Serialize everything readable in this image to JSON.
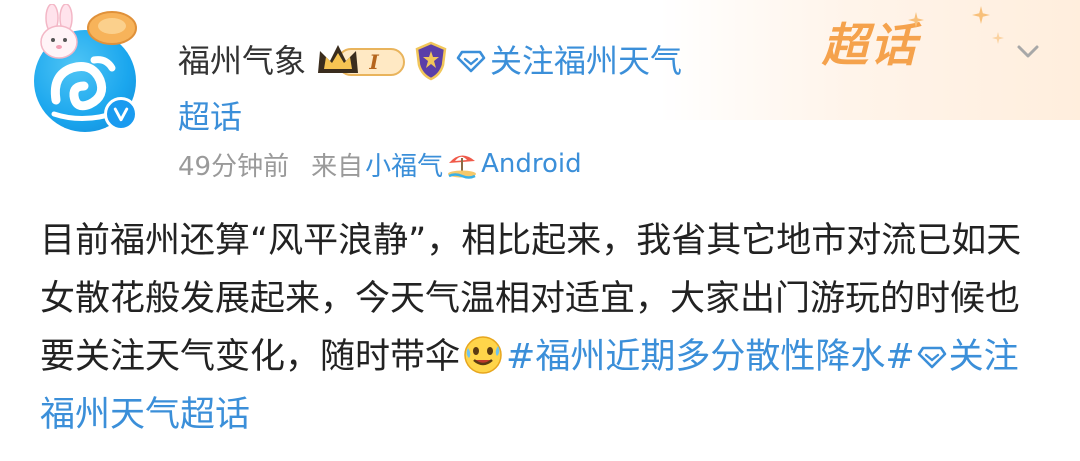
{
  "post": {
    "author": "福州气象",
    "level_badge": "I",
    "supertopic_link_line1": "关注福州天气",
    "supertopic_link_line2": "超话",
    "time_ago": "49分钟前",
    "from_label": "来自",
    "source_name": "小福气",
    "platform": "Android",
    "corner_label": "超话",
    "body_text": "目前福州还算“风平浪静”，相比起来，我省其它地市对流已如天女散花般发展起来，今天气温相对适宜，大家出门游玩的时候也要关注天气变化，随时带伞",
    "hashtag_text": "#福州近期多分散性降水#",
    "supertopic_tag": "关注福州天气超话"
  },
  "colors": {
    "link_blue": "#3b8fd9",
    "meta_gray": "#9a9a9a",
    "corner_orange": "#f5a24c",
    "verified_blue": "#1a9bf0"
  },
  "icons": {
    "avatar": "fuzhou-weather-avatar",
    "verified": "verified-v-icon",
    "crown_badge": "crown-level-icon",
    "guard": "shield-guard-icon",
    "supertopic": "diamond-icon",
    "source": "beach-umbrella-icon",
    "emoji": "sweat-smile-emoji",
    "menu": "chevron-down-icon"
  }
}
